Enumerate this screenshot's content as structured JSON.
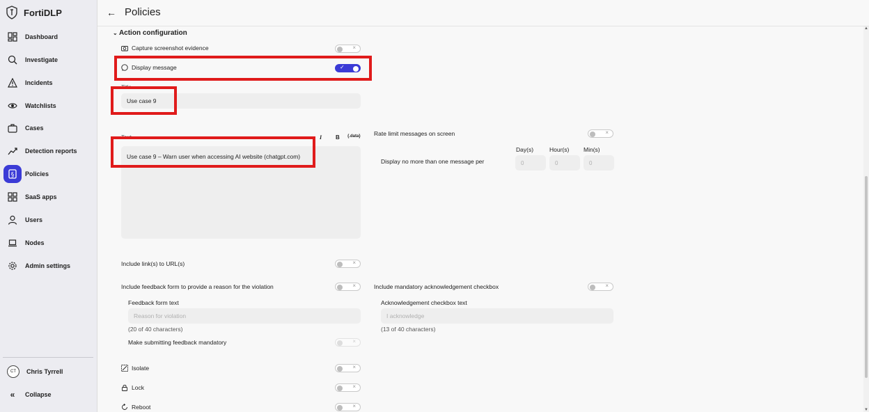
{
  "brand": {
    "name": "FortiDLP"
  },
  "nav": {
    "items": [
      {
        "label": "Dashboard",
        "icon": "dashboard-icon"
      },
      {
        "label": "Investigate",
        "icon": "search-icon"
      },
      {
        "label": "Incidents",
        "icon": "warning-icon"
      },
      {
        "label": "Watchlists",
        "icon": "eye-icon"
      },
      {
        "label": "Cases",
        "icon": "briefcase-icon"
      },
      {
        "label": "Detection reports",
        "icon": "trend-icon"
      },
      {
        "label": "Policies",
        "icon": "policy-icon",
        "active": true
      },
      {
        "label": "SaaS apps",
        "icon": "apps-icon"
      },
      {
        "label": "Users",
        "icon": "user-icon"
      },
      {
        "label": "Nodes",
        "icon": "laptop-icon"
      },
      {
        "label": "Admin settings",
        "icon": "gear-icon"
      }
    ],
    "user": {
      "initials": "CT",
      "name": "Chris Tyrrell"
    },
    "collapse_label": "Collapse"
  },
  "header": {
    "title": "Policies",
    "back_icon": "←"
  },
  "section": {
    "title": "Action configuration"
  },
  "rows": {
    "capture": {
      "label": "Capture screenshot evidence",
      "enabled": false
    },
    "display": {
      "label": "Display message",
      "enabled": true
    },
    "title_label": "Title",
    "title_value": "Use case 9",
    "text_label": "Text",
    "text_value": "Use case 9 – Warn user when accessing AI website (chatgpt.com)",
    "format": {
      "italic": "I",
      "bold": "B",
      "data": "{.data}"
    },
    "links": {
      "label": "Include link(s) to URL(s)",
      "enabled": false
    },
    "feedback": {
      "label": "Include feedback form to provide a reason for the violation",
      "enabled": false
    },
    "feedback_form_label": "Feedback form text",
    "feedback_placeholder": "Reason for violation",
    "feedback_count": "(20 of 40 characters)",
    "feedback_mandatory": {
      "label": "Make submitting feedback mandatory",
      "enabled": false
    },
    "isolate": {
      "label": "Isolate",
      "enabled": false
    },
    "lock": {
      "label": "Lock",
      "enabled": false
    },
    "reboot": {
      "label": "Reboot",
      "enabled": false
    }
  },
  "right": {
    "rate_limit": {
      "label": "Rate limit messages on screen",
      "enabled": false
    },
    "display_no_more": "Display no more than one message per",
    "columns": [
      "Day(s)",
      "Hour(s)",
      "Min(s)"
    ],
    "column_values": [
      "0",
      "0",
      "0"
    ],
    "ack": {
      "label": "Include mandatory acknowledgement checkbox",
      "enabled": false
    },
    "ack_text_label": "Acknowledgement checkbox text",
    "ack_placeholder": "I acknowledge",
    "ack_count": "(13 of 40 characters)"
  },
  "colors": {
    "accent": "#3b3bd6",
    "highlight": "#e01b1b"
  }
}
